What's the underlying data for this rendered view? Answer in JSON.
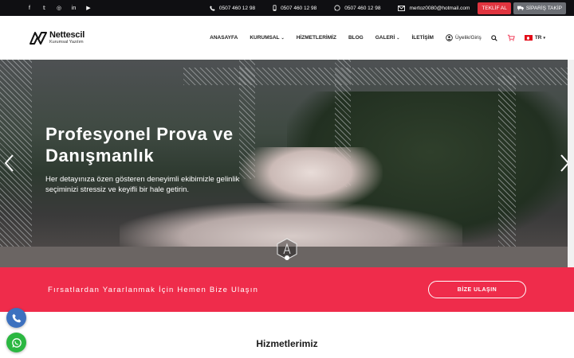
{
  "topbar": {
    "social": [
      "facebook-icon",
      "twitter-icon",
      "instagram-icon",
      "linkedin-icon",
      "youtube-icon"
    ],
    "social_glyphs": [
      "f",
      "𝕥",
      "◎",
      "in",
      "▶"
    ],
    "phone1": "0507 460 12 98",
    "mobile": "0507 460 12 98",
    "whatsapp": "0507 460 12 98",
    "email": "mertoz0080@hotmail.com",
    "offer_button": "TEKLİF AL",
    "track_button": "SİPARİŞ TAKİP"
  },
  "header": {
    "logo_name": "Nettescil",
    "logo_sub": "Kurumsal Yazılım",
    "nav": {
      "home": "ANASAYFA",
      "corporate": "KURUMSAL",
      "services": "HİZMETLERİMİZ",
      "blog": "BLOG",
      "gallery": "GALERİ",
      "contact": "İLETİŞİM"
    },
    "user_link": "Üyelik/Giriş",
    "lang": "TR"
  },
  "hero": {
    "title": "Profesyonel Prova ve Danışmanlık",
    "subtitle": "Her detayınıza özen gösteren deneyimli ekibimizle gelinlik seçiminizi stressiz ve keyifli bir hale getirin."
  },
  "cta": {
    "text": "Fırsatlardan Yararlanmak İçin Hemen Bize Ulaşın",
    "button": "BİZE ULAŞIN"
  },
  "services": {
    "title": "Hizmetlerimiz"
  },
  "colors": {
    "topbar": "#0f0f12",
    "accent": "#ef2c4b",
    "offer": "#e0343f",
    "track": "#6b6e74",
    "phone_fab": "#3d71bf",
    "whatsapp_fab": "#2bb741"
  }
}
